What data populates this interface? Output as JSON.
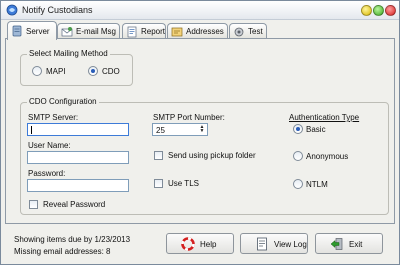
{
  "window": {
    "title": "Notify Custodians"
  },
  "tabs": [
    {
      "label": "Server",
      "icon": "server-icon"
    },
    {
      "label": "E-mail Msg",
      "icon": "email-message-icon"
    },
    {
      "label": "Report",
      "icon": "report-icon"
    },
    {
      "label": "Addresses",
      "icon": "addresses-icon"
    },
    {
      "label": "Test",
      "icon": "test-icon"
    }
  ],
  "mailing_method": {
    "legend": "Select Mailing Method",
    "options": [
      {
        "label": "MAPI",
        "selected": false
      },
      {
        "label": "CDO",
        "selected": true
      }
    ]
  },
  "cdo": {
    "legend": "CDO Configuration",
    "smtp_server_label": "SMTP Server:",
    "smtp_server_value": "",
    "user_name_label": "User Name:",
    "user_name_value": "",
    "password_label": "Password:",
    "password_value": "",
    "reveal_password_label": "Reveal Password",
    "port_label": "SMTP Port Number:",
    "port_value": "25",
    "pickup_folder_label": "Send using pickup folder",
    "use_tls_label": "Use TLS",
    "auth_type_label": "Authentication Type",
    "auth_options": [
      {
        "label": "Basic",
        "selected": true
      },
      {
        "label": "Anonymous",
        "selected": false
      },
      {
        "label": "NTLM",
        "selected": false
      }
    ]
  },
  "status": {
    "showing_items": "Showing items due by 1/23/2013",
    "missing_emails": "Missing email addresses: 8"
  },
  "buttons": {
    "help": "Help",
    "view_log": "View Log",
    "exit": "Exit"
  },
  "colors": {
    "accent": "#2a5db8",
    "window_bg": "#f0f0ec",
    "help_icon": "#d42020",
    "exit_icon": "#2d9a2d"
  }
}
